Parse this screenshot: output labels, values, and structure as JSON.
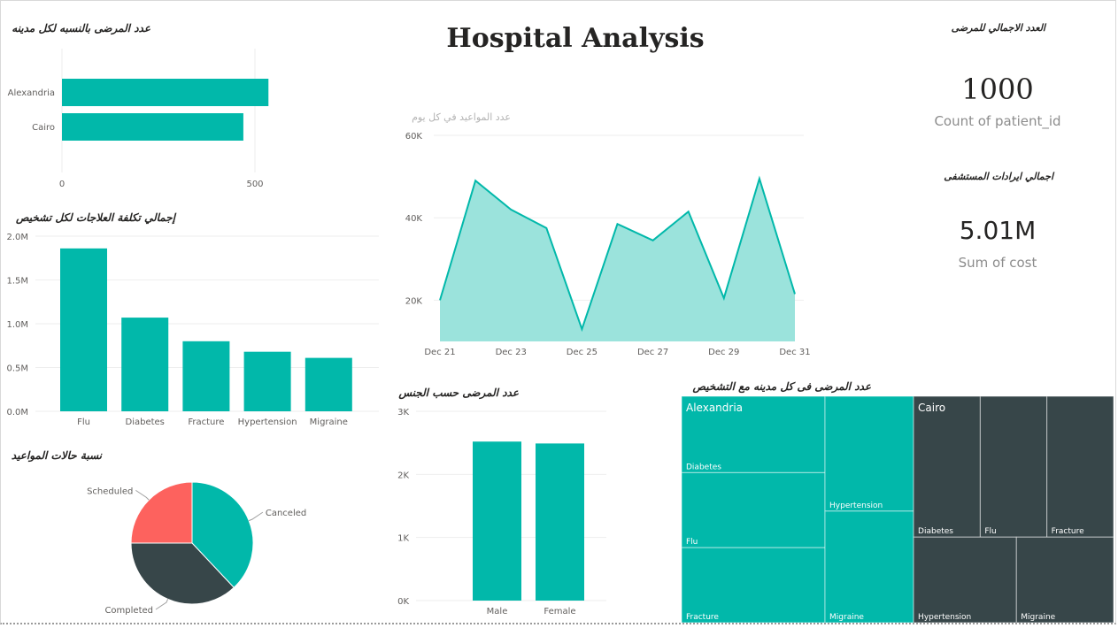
{
  "dashboard": {
    "title": "Hospital Analysis"
  },
  "cards": {
    "patients": {
      "title": "العدد الاجمالي للمرضى",
      "value": "1000",
      "label": "Count of patient_id"
    },
    "revenue": {
      "title": "اجمالي ايرادات المستشفى",
      "value": "5.01M",
      "label": "Sum of cost"
    }
  },
  "colors": {
    "teal": "#01b8aa",
    "teal_light": "#9be3dc",
    "dark": "#374649",
    "red": "#fd625e",
    "grid": "#eeeeee",
    "axis": "#605e5c"
  },
  "chart_data": [
    {
      "id": "city_patients",
      "type": "bar",
      "orientation": "horizontal",
      "title": "عدد المرضى بالنسبه لكل مدينه",
      "categories": [
        "Alexandria",
        "Cairo"
      ],
      "values": [
        535,
        470
      ],
      "xlim": [
        0,
        600
      ],
      "xticks": [
        0,
        500
      ],
      "xtick_labels": [
        "0",
        "500"
      ]
    },
    {
      "id": "diagnosis_cost",
      "type": "bar",
      "title": "إجمالي تكلفة العلاجات لكل تشخيص",
      "categories": [
        "Flu",
        "Diabetes",
        "Fracture",
        "Hypertension",
        "Migraine"
      ],
      "values": [
        1860000,
        1070000,
        800000,
        680000,
        610000
      ],
      "ylim": [
        0,
        2000000
      ],
      "yticks": [
        0,
        500000,
        1000000,
        1500000,
        2000000
      ],
      "ytick_labels": [
        "0.0M",
        "0.5M",
        "1.0M",
        "1.5M",
        "2.0M"
      ]
    },
    {
      "id": "appointments_daily",
      "type": "area",
      "title": "عدد المواعيد في كل يوم",
      "x": [
        "Dec 21",
        "Dec 22",
        "Dec 23",
        "Dec 24",
        "Dec 25",
        "Dec 26",
        "Dec 27",
        "Dec 28",
        "Dec 29",
        "Dec 30",
        "Dec 31"
      ],
      "values": [
        20000,
        49000,
        42000,
        37500,
        13000,
        38500,
        34500,
        41500,
        20500,
        49500,
        21500
      ],
      "x_tick_labels": [
        "Dec 21",
        "Dec 23",
        "Dec 25",
        "Dec 27",
        "Dec 29",
        "Dec 31"
      ],
      "ylim": [
        10000,
        60000
      ],
      "yticks": [
        20000,
        40000,
        60000
      ],
      "ytick_labels": [
        "20K",
        "40K",
        "60K"
      ]
    },
    {
      "id": "gender_patients",
      "type": "bar",
      "title": "عدد المرضى حسب الجنس",
      "categories": [
        "Male",
        "Female"
      ],
      "values": [
        2520,
        2490
      ],
      "ylim": [
        0,
        3000
      ],
      "yticks": [
        0,
        1000,
        2000,
        3000
      ],
      "ytick_labels": [
        "0K",
        "1K",
        "2K",
        "3K"
      ]
    },
    {
      "id": "appointment_status",
      "type": "pie",
      "title": "نسبة حالات المواعيد",
      "slices": [
        {
          "label": "Canceled",
          "value": 38
        },
        {
          "label": "Completed",
          "value": 37
        },
        {
          "label": "Scheduled",
          "value": 25
        }
      ]
    },
    {
      "id": "city_diagnosis",
      "type": "treemap",
      "title": "عدد المرضى فى كل مدينه مع التشخيص",
      "groups": [
        {
          "name": "Alexandria",
          "value": 537,
          "children": [
            {
              "name": "Diabetes",
              "value": 112
            },
            {
              "name": "Flu",
              "value": 110
            },
            {
              "name": "Fracture",
              "value": 110
            },
            {
              "name": "Hypertension",
              "value": 104
            },
            {
              "name": "Migraine",
              "value": 101
            }
          ]
        },
        {
          "name": "Cairo",
          "value": 463,
          "children": [
            {
              "name": "Diabetes",
              "value": 96
            },
            {
              "name": "Flu",
              "value": 96
            },
            {
              "name": "Fracture",
              "value": 96
            },
            {
              "name": "Hypertension",
              "value": 90
            },
            {
              "name": "Migraine",
              "value": 85
            }
          ]
        }
      ]
    }
  ]
}
